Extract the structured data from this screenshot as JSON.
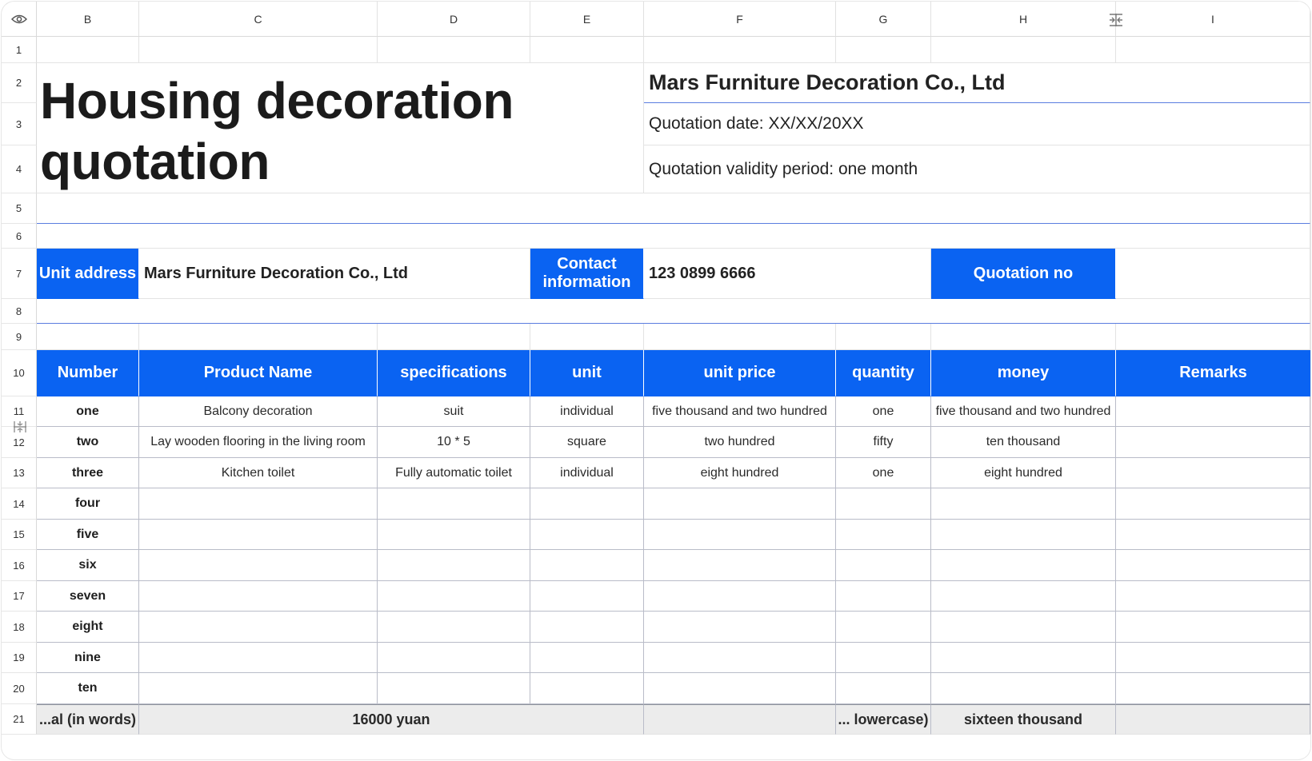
{
  "columns": [
    "B",
    "C",
    "D",
    "E",
    "F",
    "G",
    "H",
    "I"
  ],
  "rows": [
    "1",
    "2",
    "3",
    "4",
    "5",
    "6",
    "7",
    "8",
    "9",
    "10",
    "11",
    "12",
    "13",
    "14",
    "15",
    "16",
    "17",
    "18",
    "19",
    "20",
    "21"
  ],
  "title": "Housing decoration quotation",
  "company": "Mars Furniture Decoration Co., Ltd",
  "quotation_date": "Quotation date: XX/XX/20XX",
  "validity": "Quotation validity period: one month",
  "info": {
    "unit_address_label": "Unit address",
    "unit_address_value": "Mars Furniture Decoration Co., Ltd",
    "contact_label": "Contact information",
    "contact_value": "123 0899 6666",
    "quotation_no_label": "Quotation no"
  },
  "table": {
    "headers": [
      "Number",
      "Product Name",
      "specifications",
      "unit",
      "unit price",
      "quantity",
      "money",
      "Remarks"
    ],
    "rows": [
      [
        "one",
        "Balcony decoration",
        "suit",
        "individual",
        "five thousand and two hundred",
        "one",
        "five thousand and two hundred",
        ""
      ],
      [
        "two",
        "Lay wooden flooring in the living room",
        "10 * 5",
        "square",
        "two hundred",
        "fifty",
        "ten thousand",
        ""
      ],
      [
        "three",
        "Kitchen toilet",
        "Fully automatic toilet",
        "individual",
        "eight hundred",
        "one",
        "eight hundred",
        ""
      ],
      [
        "four",
        "",
        "",
        "",
        "",
        "",
        "",
        ""
      ],
      [
        "five",
        "",
        "",
        "",
        "",
        "",
        "",
        ""
      ],
      [
        "six",
        "",
        "",
        "",
        "",
        "",
        "",
        ""
      ],
      [
        "seven",
        "",
        "",
        "",
        "",
        "",
        "",
        ""
      ],
      [
        "eight",
        "",
        "",
        "",
        "",
        "",
        "",
        ""
      ],
      [
        "nine",
        "",
        "",
        "",
        "",
        "",
        "",
        ""
      ],
      [
        "ten",
        "",
        "",
        "",
        "",
        "",
        "",
        ""
      ]
    ]
  },
  "total": {
    "words_label": "...al (in words)",
    "words_value": "16000 yuan",
    "lower_label": "... lowercase)",
    "lower_value": "sixteen thousand"
  },
  "icons": {
    "corner": "eye-icon",
    "resize": "column-resize-icon"
  },
  "colors": {
    "accent": "#0a63f2",
    "divider": "#5a7de0"
  }
}
